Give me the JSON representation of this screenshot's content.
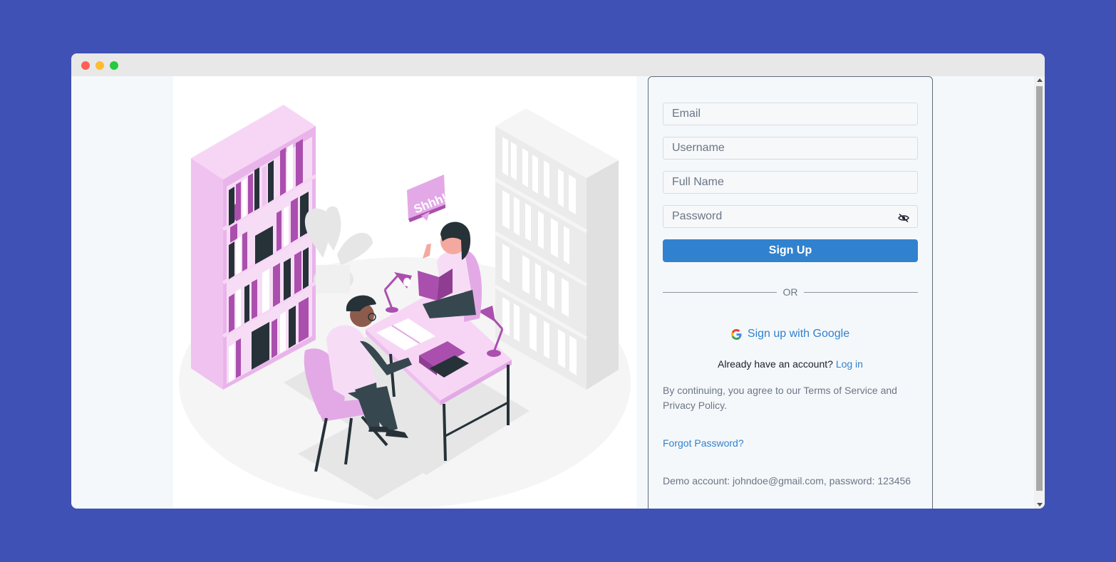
{
  "window": {
    "controls": [
      "close",
      "minimize",
      "maximize"
    ]
  },
  "illustration": {
    "speech_bubble_text": "Shhh!",
    "colors": {
      "accent_pink": "#e3a9e6",
      "accent_purple": "#ab4fae",
      "dark": "#263238",
      "light_grey": "#ebebeb"
    }
  },
  "form": {
    "email_placeholder": "Email",
    "username_placeholder": "Username",
    "fullname_placeholder": "Full Name",
    "password_placeholder": "Password",
    "password_toggle_icon": "eye-off-icon",
    "signup_label": "Sign Up",
    "or_text": "OR",
    "google_label": "Sign up with Google",
    "google_icon": "google-icon",
    "have_account_text": "Already have an account?",
    "login_label": "Log in",
    "terms_text": "By continuing, you agree to our Terms of Service and Privacy Policy.",
    "forgot_label": "Forgot Password?",
    "demo_text": "Demo account: johndoe@gmail.com, password: 123456"
  },
  "colors": {
    "page_background": "#3f51b5",
    "primary": "#3182ce",
    "muted_text": "#6b7685"
  }
}
